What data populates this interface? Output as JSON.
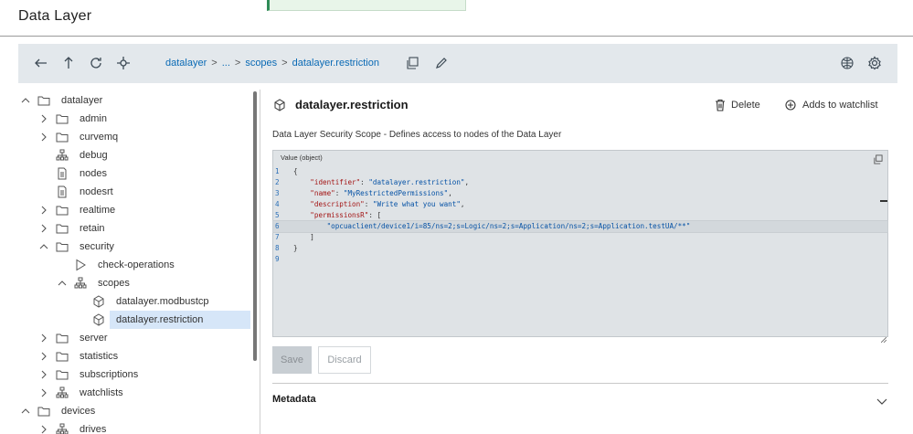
{
  "header": {
    "title": "Data Layer"
  },
  "toolbar": {
    "breadcrumb": [
      "datalayer",
      "...",
      "scopes",
      "datalayer.restriction"
    ],
    "breadcrumb_separator": ">"
  },
  "tree": {
    "items": [
      {
        "label": "datalayer",
        "icon": "folder-icon",
        "expand": "expanded",
        "depth": 0
      },
      {
        "label": "admin",
        "icon": "folder-icon",
        "expand": "collapsed",
        "depth": 1
      },
      {
        "label": "curvemq",
        "icon": "folder-icon",
        "expand": "collapsed",
        "depth": 1
      },
      {
        "label": "debug",
        "icon": "hierarchy-icon",
        "expand": "none",
        "depth": 1
      },
      {
        "label": "nodes",
        "icon": "document-icon",
        "expand": "none",
        "depth": 1
      },
      {
        "label": "nodesrt",
        "icon": "document-icon",
        "expand": "none",
        "depth": 1
      },
      {
        "label": "realtime",
        "icon": "folder-icon",
        "expand": "collapsed",
        "depth": 1
      },
      {
        "label": "retain",
        "icon": "folder-icon",
        "expand": "collapsed",
        "depth": 1
      },
      {
        "label": "security",
        "icon": "folder-icon",
        "expand": "expanded",
        "depth": 1
      },
      {
        "label": "check-operations",
        "icon": "play-icon",
        "expand": "none",
        "depth": 2
      },
      {
        "label": "scopes",
        "icon": "hierarchy-icon",
        "expand": "expanded",
        "depth": 2
      },
      {
        "label": "datalayer.modbustcp",
        "icon": "cube-icon",
        "expand": "none",
        "depth": 3
      },
      {
        "label": "datalayer.restriction",
        "icon": "cube-icon",
        "expand": "none",
        "depth": 3,
        "selected": true
      },
      {
        "label": "server",
        "icon": "folder-icon",
        "expand": "collapsed",
        "depth": 1
      },
      {
        "label": "statistics",
        "icon": "folder-icon",
        "expand": "collapsed",
        "depth": 1
      },
      {
        "label": "subscriptions",
        "icon": "folder-icon",
        "expand": "collapsed",
        "depth": 1
      },
      {
        "label": "watchlists",
        "icon": "hierarchy-icon",
        "expand": "collapsed",
        "depth": 1
      },
      {
        "label": "devices",
        "icon": "folder-icon",
        "expand": "expanded",
        "depth": 0
      },
      {
        "label": "drives",
        "icon": "hierarchy-icon",
        "expand": "collapsed",
        "depth": 1
      }
    ]
  },
  "detail": {
    "title": "datalayer.restriction",
    "delete_label": "Delete",
    "watchlist_label": "Adds to watchlist",
    "description": "Data Layer Security Scope - Defines access to nodes of the Data Layer",
    "value_header": "Value (object)",
    "code_lines": [
      {
        "num": "1",
        "parts": [
          [
            "p",
            "{"
          ]
        ]
      },
      {
        "num": "2",
        "parts": [
          [
            "p",
            "    "
          ],
          [
            "k",
            "\"identifier\""
          ],
          [
            "p",
            ": "
          ],
          [
            "s",
            "\"datalayer.restriction\""
          ],
          [
            "p",
            ","
          ]
        ]
      },
      {
        "num": "3",
        "parts": [
          [
            "p",
            "    "
          ],
          [
            "k",
            "\"name\""
          ],
          [
            "p",
            ": "
          ],
          [
            "s",
            "\"MyRestrictedPermissions\""
          ],
          [
            "p",
            ","
          ]
        ]
      },
      {
        "num": "4",
        "parts": [
          [
            "p",
            "    "
          ],
          [
            "k",
            "\"description\""
          ],
          [
            "p",
            ": "
          ],
          [
            "s",
            "\"Write what you want\""
          ],
          [
            "p",
            ","
          ]
        ]
      },
      {
        "num": "5",
        "parts": [
          [
            "p",
            "    "
          ],
          [
            "k",
            "\"permissionsR\""
          ],
          [
            "p",
            ": ["
          ]
        ]
      },
      {
        "num": "6",
        "parts": [
          [
            "p",
            "        "
          ],
          [
            "s",
            "\"opcuaclient/device1/i=85/ns=2;s=Logic/ns=2;s=Application/ns=2;s=Application.testUA/**\""
          ]
        ],
        "highlight": true
      },
      {
        "num": "7",
        "parts": [
          [
            "p",
            "    ]"
          ]
        ]
      },
      {
        "num": "8",
        "parts": [
          [
            "p",
            "}"
          ]
        ]
      },
      {
        "num": "9",
        "parts": []
      }
    ],
    "save_label": "Save",
    "discard_label": "Discard",
    "metadata_label": "Metadata"
  }
}
